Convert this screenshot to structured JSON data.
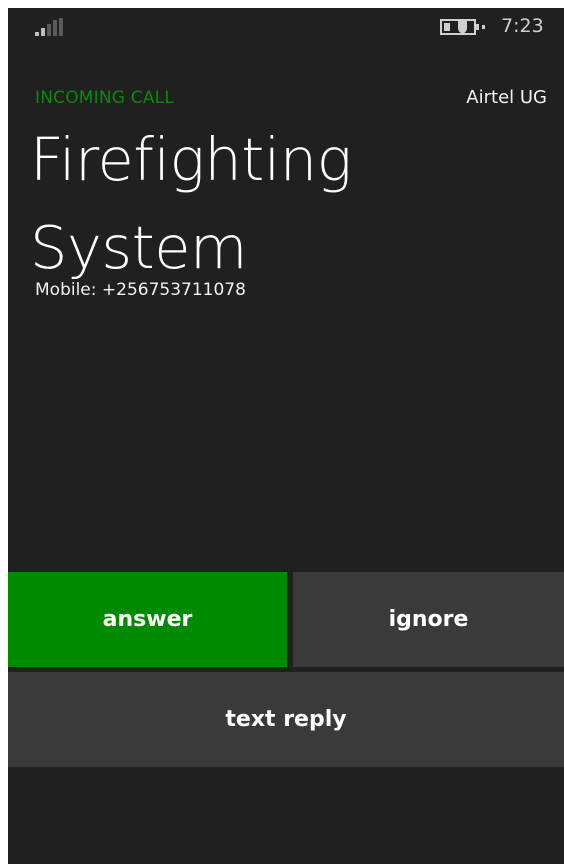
{
  "status_bar": {
    "signal_icon": "signal-strength-icon",
    "battery_icon": "battery-saver-icon",
    "time": "7:23"
  },
  "call": {
    "status_label": "INCOMING CALL",
    "carrier": "Airtel UG",
    "caller_name": "Firefighting System",
    "caller_number": "Mobile: +256753711078"
  },
  "actions": {
    "answer_label": "answer",
    "ignore_label": "ignore",
    "text_reply_label": "text reply"
  },
  "colors": {
    "background": "#202020",
    "accent": "#008a00",
    "button": "#3a3a3a"
  }
}
